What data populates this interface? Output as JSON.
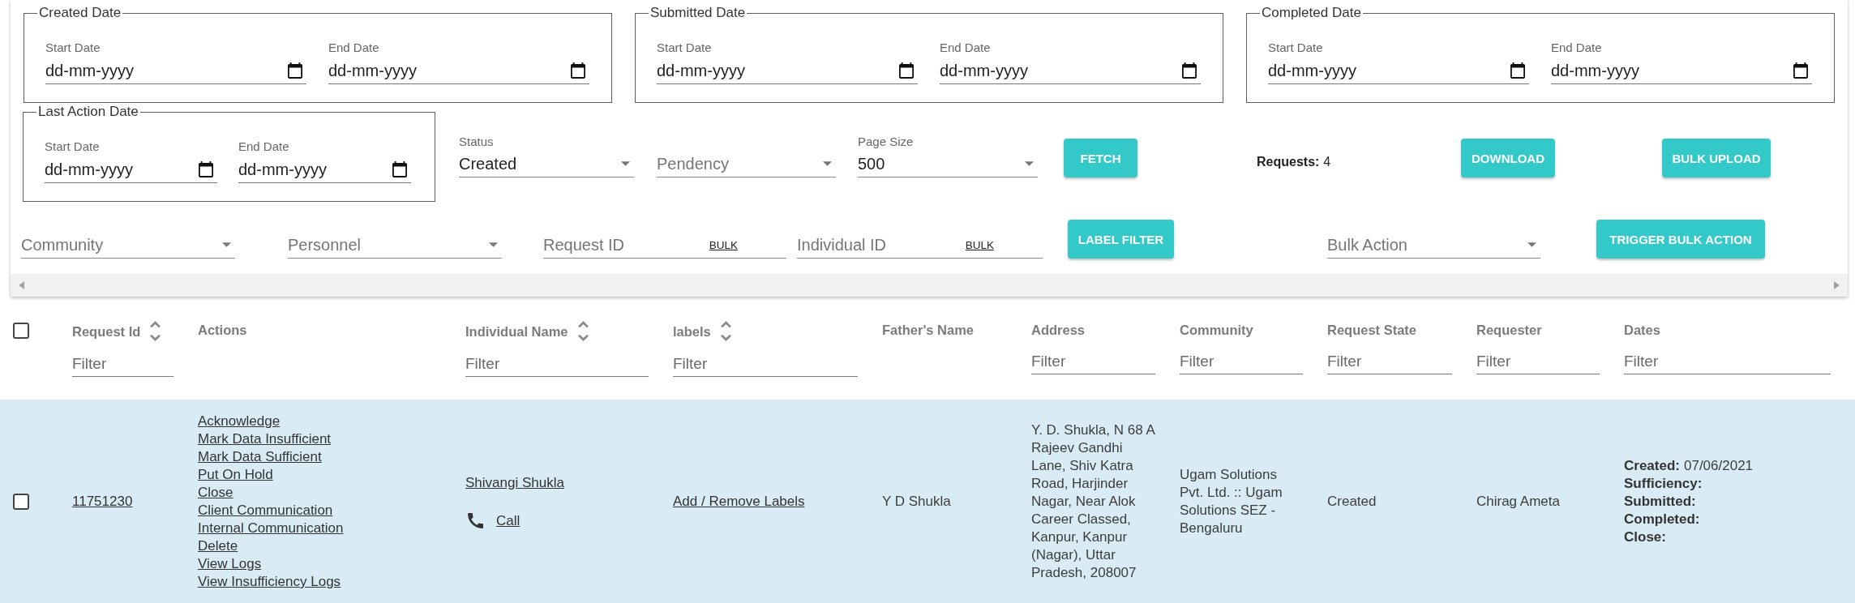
{
  "filters": {
    "date_ranges": [
      {
        "legend": "Created Date",
        "start": {
          "label": "Start Date",
          "placeholder": "dd-mm-yyyy"
        },
        "end": {
          "label": "End Date",
          "placeholder": "dd-mm-yyyy"
        }
      },
      {
        "legend": "Submitted Date",
        "start": {
          "label": "Start Date",
          "placeholder": "dd-mm-yyyy"
        },
        "end": {
          "label": "End Date",
          "placeholder": "dd-mm-yyyy"
        }
      },
      {
        "legend": "Completed Date",
        "start": {
          "label": "Start Date",
          "placeholder": "dd-mm-yyyy"
        },
        "end": {
          "label": "End Date",
          "placeholder": "dd-mm-yyyy"
        }
      },
      {
        "legend": "Last Action Date",
        "start": {
          "label": "Start Date",
          "placeholder": "dd-mm-yyyy"
        },
        "end": {
          "label": "End Date",
          "placeholder": "dd-mm-yyyy"
        }
      }
    ],
    "status": {
      "label": "Status",
      "value": "Created"
    },
    "pendency": {
      "placeholder": "Pendency"
    },
    "page_size": {
      "label": "Page Size",
      "value": "500"
    },
    "fetch_button": "FETCH",
    "requests": {
      "label": "Requests:",
      "count": "4"
    },
    "download_button": "DOWNLOAD",
    "bulk_upload_button": "BULK UPLOAD",
    "community": {
      "placeholder": "Community"
    },
    "personnel": {
      "placeholder": "Personnel"
    },
    "request_id": {
      "placeholder": "Request ID",
      "bulk_link": "BULK"
    },
    "individual_id": {
      "placeholder": "Individual ID",
      "bulk_link": "BULK"
    },
    "label_filter_button": "LABEL FILTER",
    "bulk_action": {
      "placeholder": "Bulk Action"
    },
    "trigger_bulk_action_button": "TRIGGER BULK ACTION"
  },
  "table": {
    "select_all": {
      "checked": false
    },
    "columns": [
      {
        "label": "Request Id",
        "sortable": true,
        "filter": {
          "placeholder": "Filter"
        }
      },
      {
        "label": "Actions",
        "sortable": false
      },
      {
        "label": "Individual Name",
        "sortable": true,
        "filter": {
          "placeholder": "Filter"
        }
      },
      {
        "label": "labels",
        "sortable": true,
        "filter": {
          "placeholder": "Filter"
        }
      },
      {
        "label": "Father's Name",
        "sortable": false
      },
      {
        "label": "Address",
        "sortable": false,
        "filter": {
          "placeholder": "Filter"
        }
      },
      {
        "label": "Community",
        "sortable": false,
        "filter": {
          "placeholder": "Filter"
        }
      },
      {
        "label": "Request State",
        "sortable": false,
        "filter": {
          "placeholder": "Filter"
        }
      },
      {
        "label": "Requester",
        "sortable": false,
        "filter": {
          "placeholder": "Filter"
        }
      },
      {
        "label": "Dates",
        "sortable": false,
        "filter": {
          "placeholder": "Filter"
        }
      }
    ],
    "rows": [
      {
        "checked": false,
        "highlighted": true,
        "request_id": "11751230",
        "actions": [
          "Acknowledge",
          "Mark Data Insufficient",
          "Mark Data Sufficient",
          "Put On Hold",
          "Close",
          "Client Communication",
          "Internal Communication",
          "Delete",
          "View Logs",
          "View Insufficiency Logs"
        ],
        "individual_name": "Shivangi Shukla",
        "call_link": "Call",
        "labels_link": "Add / Remove Labels",
        "fathers_name": "Y D Shukla",
        "address": "Y. D. Shukla, N 68 A Rajeev Gandhi Lane, Shiv Katra Road, Harjinder Nagar, Near Alok Career Classed, Kanpur, Kanpur (Nagar), Uttar Pradesh, 208007",
        "community": "Ugam Solutions Pvt. Ltd. :: Ugam Solutions SEZ - Bengaluru",
        "request_state": "Created",
        "requester": "Chirag Ameta",
        "dates": [
          {
            "label": "Created:",
            "value": "07/06/2021"
          },
          {
            "label": "Sufficiency:"
          },
          {
            "label": "Submitted:"
          },
          {
            "label": "Completed:"
          },
          {
            "label": "Close:"
          }
        ]
      }
    ]
  }
}
